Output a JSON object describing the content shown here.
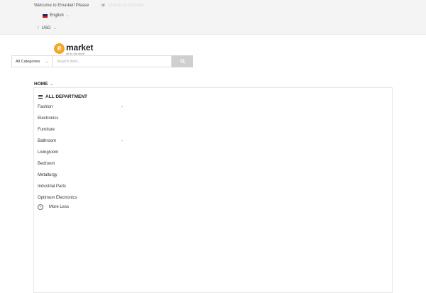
{
  "topbar": {
    "welcome_text": "Welcome to Emarket! Please",
    "login_label": "",
    "or_text": "or",
    "register_label": "Create an Account",
    "language": {
      "label": "English",
      "flag_icon": "uk-flag-icon"
    },
    "currency": {
      "separator": "I",
      "label": "USD"
    }
  },
  "logo": {
    "mark": "e",
    "name": "market",
    "tagline": "all in one store",
    "accent_color": "#f5a623"
  },
  "search": {
    "category_label": "All Categories",
    "placeholder": "Search item...",
    "button_icon": "search-icon"
  },
  "nav": {
    "home_label": "HOME"
  },
  "departments": {
    "title": "ALL DEPARTMENT",
    "items": [
      {
        "label": "Fashion",
        "has_submenu": true
      },
      {
        "label": "Electronics",
        "has_submenu": false
      },
      {
        "label": "Furniture",
        "has_submenu": false
      },
      {
        "label": "Bathroom",
        "has_submenu": true
      },
      {
        "label": "Livingroom",
        "has_submenu": false
      },
      {
        "label": "Bedroom",
        "has_submenu": false
      },
      {
        "label": "Metallurgy",
        "has_submenu": false
      },
      {
        "label": "Industrial Parts",
        "has_submenu": false
      },
      {
        "label": "Optimum Electronics",
        "has_submenu": false
      }
    ],
    "more_less_label": "More Less"
  }
}
